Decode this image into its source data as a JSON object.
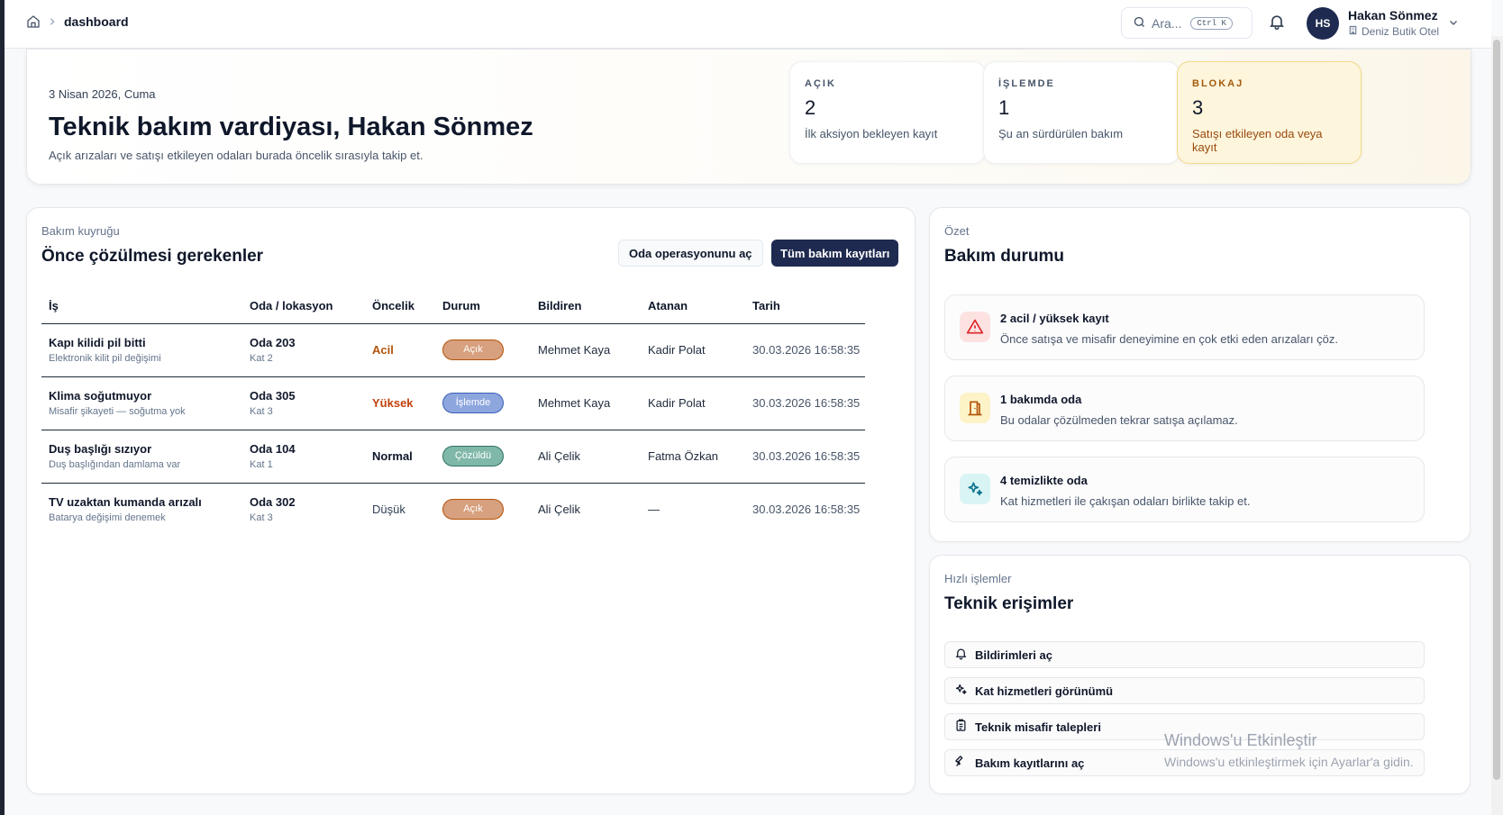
{
  "breadcrumb": {
    "current": "dashboard"
  },
  "header": {
    "search_placeholder": "Ara...",
    "search_shortcut": "Ctrl K",
    "user_initials": "HS",
    "user_name": "Hakan Sönmez",
    "hotel_name": "Deniz Butik Otel"
  },
  "hero": {
    "date": "3 Nisan 2026, Cuma",
    "title": "Teknik bakım vardiyası, Hakan Sönmez",
    "subtitle": "Açık arızaları ve satışı etkileyen odaları burada öncelik sırasıyla takip et.",
    "stats": [
      {
        "label": "AÇIK",
        "value": "2",
        "desc": "İlk aksiyon bekleyen kayıt"
      },
      {
        "label": "İŞLEMDE",
        "value": "1",
        "desc": "Şu an sürdürülen bakım"
      },
      {
        "label": "BLOKAJ",
        "value": "3",
        "desc": "Satışı etkileyen oda veya kayıt"
      }
    ]
  },
  "queue": {
    "kicker": "Bakım kuyruğu",
    "title": "Önce çözülmesi gerekenler",
    "btn_rooms": "Oda operasyonunu aç",
    "btn_all": "Tüm bakım kayıtları",
    "columns": [
      "İş",
      "Oda / lokasyon",
      "Öncelik",
      "Durum",
      "Bildiren",
      "Atanan",
      "Tarih"
    ],
    "rows": [
      {
        "title": "Kapı kilidi pil bitti",
        "sub": "Elektronik kilit pil değişimi",
        "room": "Oda 203",
        "floor": "Kat 2",
        "priority": "Acil",
        "status": "Açık",
        "reporter": "Mehmet Kaya",
        "assignee": "Kadir Polat",
        "date": "30.03.2026 16:58:35"
      },
      {
        "title": "Klima soğutmuyor",
        "sub": "Misafir şikayeti — soğutma yok",
        "room": "Oda 305",
        "floor": "Kat 3",
        "priority": "Yüksek",
        "status": "İşlemde",
        "reporter": "Mehmet Kaya",
        "assignee": "Kadir Polat",
        "date": "30.03.2026 16:58:35"
      },
      {
        "title": "Duş başlığı sızıyor",
        "sub": "Duş başlığından damlama var",
        "room": "Oda 104",
        "floor": "Kat 1",
        "priority": "Normal",
        "status": "Çözüldü",
        "reporter": "Ali Çelik",
        "assignee": "Fatma Özkan",
        "date": "30.03.2026 16:58:35"
      },
      {
        "title": "TV uzaktan kumanda arızalı",
        "sub": "Batarya değişimi denemek",
        "room": "Oda 302",
        "floor": "Kat 3",
        "priority": "Düşük",
        "status": "Açık",
        "reporter": "Ali Çelik",
        "assignee": "—",
        "date": "30.03.2026 16:58:35"
      }
    ]
  },
  "summary": {
    "kicker": "Özet",
    "title": "Bakım durumu",
    "items": [
      {
        "title": "2 acil / yüksek kayıt",
        "desc": "Önce satışa ve misafir deneyimine en çok etki eden arızaları çöz.",
        "icon": "warning-icon"
      },
      {
        "title": "1 bakımda oda",
        "desc": "Bu odalar çözülmeden tekrar satışa açılamaz.",
        "icon": "door-icon"
      },
      {
        "title": "4 temizlikte oda",
        "desc": "Kat hizmetleri ile çakışan odaları birlikte takip et.",
        "icon": "sparkle-icon"
      }
    ]
  },
  "quick": {
    "kicker": "Hızlı işlemler",
    "title": "Teknik erişimler",
    "items": [
      {
        "label": "Bildirimleri aç",
        "icon": "bell-icon"
      },
      {
        "label": "Kat hizmetleri görünümü",
        "icon": "sparkle-icon"
      },
      {
        "label": "Teknik misafir talepleri",
        "icon": "clipboard-icon"
      },
      {
        "label": "Bakım kayıtlarını aç",
        "icon": "wrench-icon"
      }
    ]
  },
  "watermark": {
    "line1": "Windows'u Etkinleştir",
    "line2": "Windows'u etkinleştirmek için Ayarlar'a gidin."
  },
  "colors": {
    "primary": "#1e2a4f",
    "urgent": "#b45309",
    "high": "#c2410c",
    "open_pill": "#d7a07e",
    "progress_pill": "#8ea6de",
    "done_pill": "#7fb7a8",
    "blockage_bg": "#fdf5dc"
  }
}
